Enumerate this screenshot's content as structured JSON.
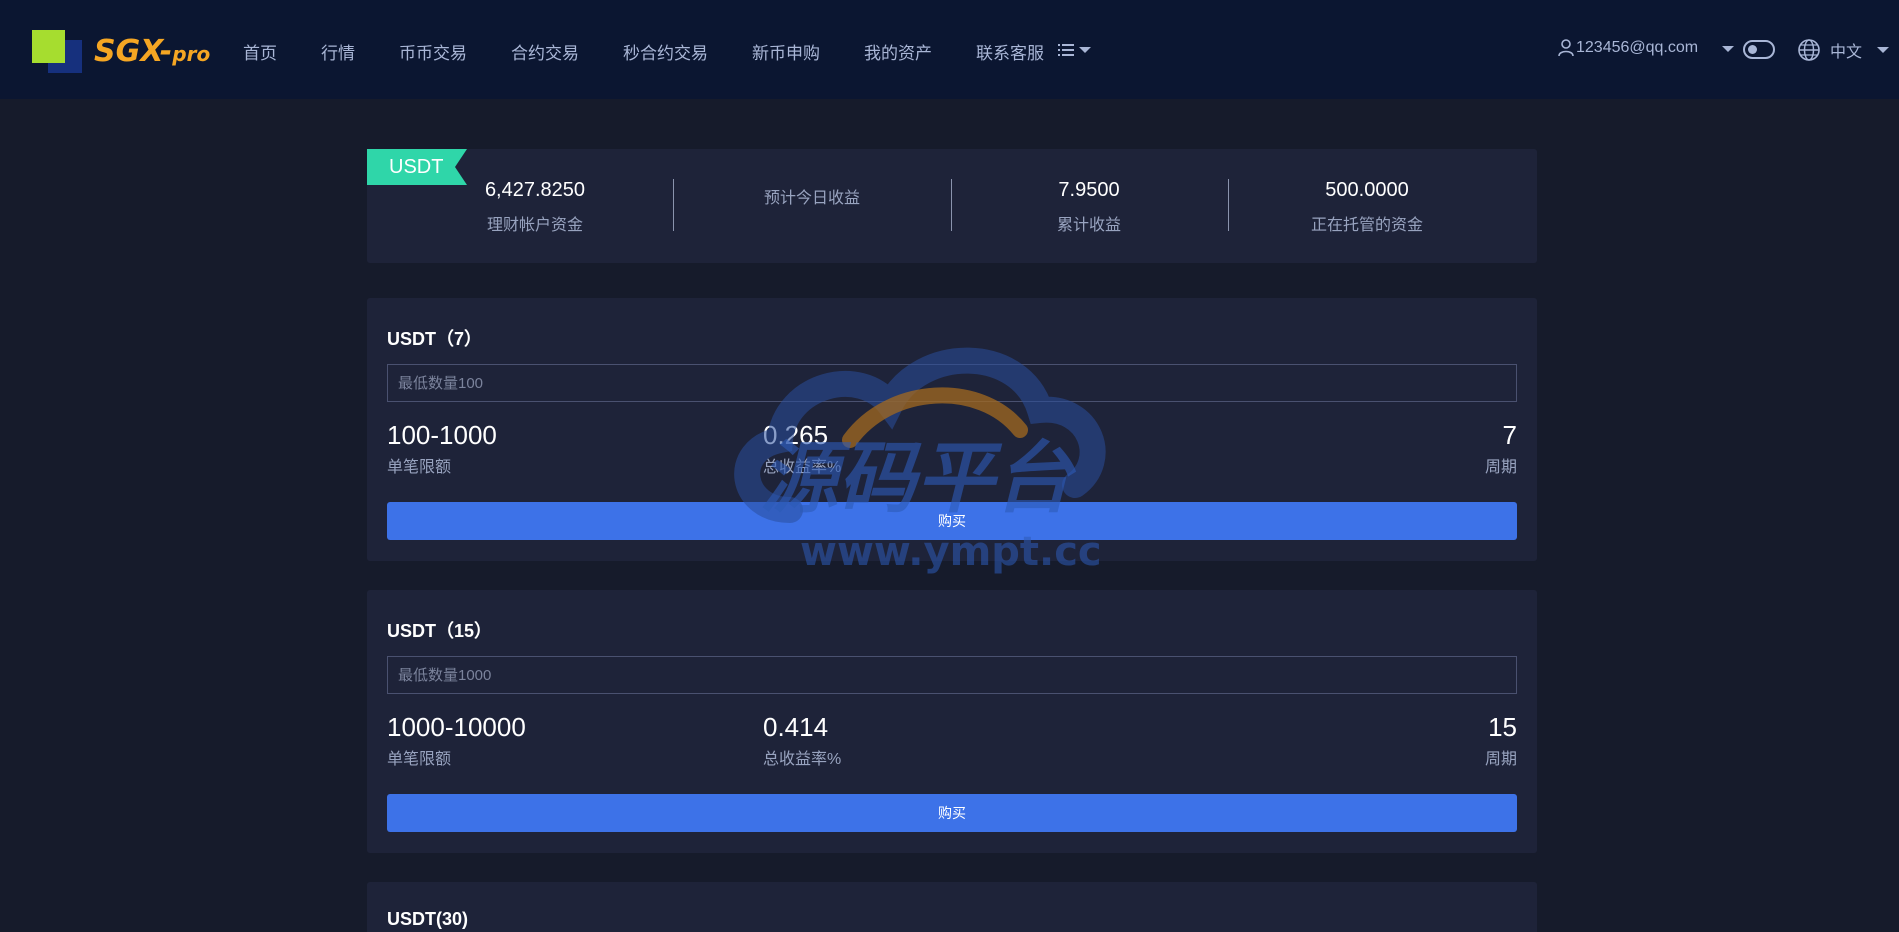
{
  "header": {
    "logo_main": "SGX-",
    "logo_sub": "pro",
    "nav": [
      "首页",
      "行情",
      "币币交易",
      "合约交易",
      "秒合约交易",
      "新币申购",
      "我的资产",
      "联系客服"
    ],
    "user_email": "123456@qq.com",
    "language": "中文"
  },
  "summary": {
    "ribbon": "USDT",
    "stats": [
      {
        "value": "6,427.8250",
        "label": "理财帐户资金"
      },
      {
        "value": "",
        "label": "预计今日收益"
      },
      {
        "value": "7.9500",
        "label": "累计收益"
      },
      {
        "value": "500.0000",
        "label": "正在托管的资金"
      }
    ]
  },
  "products": [
    {
      "title": "USDT（7）",
      "placeholder": "最低数量100",
      "limit": "100-1000",
      "limit_label": "单笔限额",
      "rate": "0.265",
      "rate_label": "总收益率%",
      "period": "7",
      "period_label": "周期",
      "buy": "购买"
    },
    {
      "title": "USDT（15）",
      "placeholder": "最低数量1000",
      "limit": "1000-10000",
      "limit_label": "单笔限额",
      "rate": "0.414",
      "rate_label": "总收益率%",
      "period": "15",
      "period_label": "周期",
      "buy": "购买"
    },
    {
      "title": "USDT(30)"
    }
  ],
  "watermark": {
    "text": "源码平台",
    "url": "www.ympt.cc"
  },
  "colors": {
    "background": "#161b2b",
    "header": "#0b1631",
    "card": "#1e2339",
    "ribbon": "#2fd6a9",
    "button": "#3d72e8",
    "logo_orange": "#f5a623",
    "logo_green": "#a6dd2f"
  }
}
